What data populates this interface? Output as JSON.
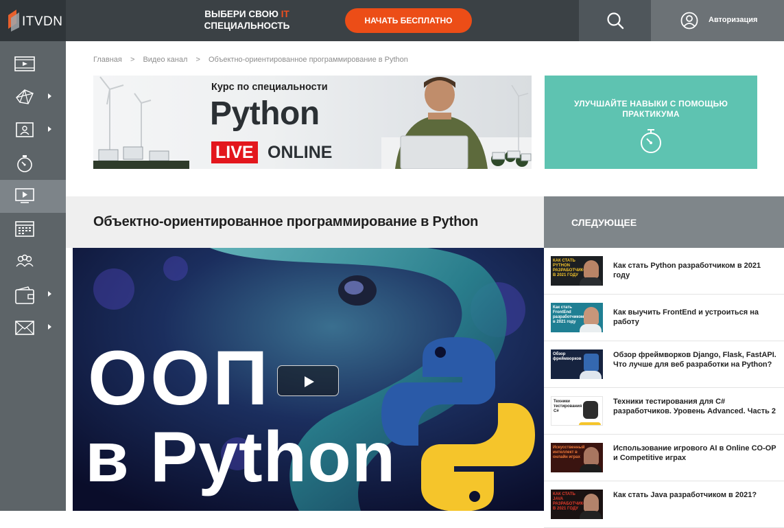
{
  "brand": {
    "name": "ITVDN"
  },
  "header": {
    "slogan_line1": "ВЫБЕРИ СВОЮ",
    "slogan_accent": "IT",
    "slogan_line2": "СПЕЦИАЛЬНОСТЬ",
    "cta_label": "НАЧАТЬ БЕСПЛАТНО",
    "auth_label": "Авторизация"
  },
  "sidebar": {
    "items": [
      {
        "icon": "video-library-icon",
        "has_submenu": false
      },
      {
        "icon": "network-icon",
        "has_submenu": true
      },
      {
        "icon": "teacher-icon",
        "has_submenu": true
      },
      {
        "icon": "stopwatch-icon",
        "has_submenu": false
      },
      {
        "icon": "play-screen-icon",
        "has_submenu": false,
        "active": true
      },
      {
        "icon": "calendar-icon",
        "has_submenu": false
      },
      {
        "icon": "users-icon",
        "has_submenu": false
      },
      {
        "icon": "wallet-icon",
        "has_submenu": true
      },
      {
        "icon": "mail-icon",
        "has_submenu": true
      }
    ]
  },
  "breadcrumb": {
    "items": [
      "Главная",
      "Видео канал",
      "Объектно-ориентированное программирование в Python"
    ],
    "separator": ">"
  },
  "banner": {
    "kicker": "Курс по специальности",
    "title": "Python",
    "live": "LIVE",
    "online": "ONLINE"
  },
  "promo": {
    "text": "УЛУЧШАЙТЕ НАВЫКИ С ПОМОЩЬЮ ПРАКТИКУМА",
    "icon": "stopwatch-icon"
  },
  "page": {
    "title": "Объектно-ориентированное программирование в Python"
  },
  "video": {
    "overlay_line1": "ООП",
    "overlay_line2": "в Python"
  },
  "next": {
    "heading": "СЛЕДУЮЩЕЕ",
    "items": [
      {
        "title": "Как стать Python разработчиком в 2021 году",
        "thumb_text": "КАК СТАТЬ PYTHON РАЗРАБОТЧИКОМ В 2021 ГОДУ"
      },
      {
        "title": "Как выучить FrontEnd и устроиться на работу",
        "thumb_text": "Как стать FrontEnd разработчиком в 2021 году"
      },
      {
        "title": "Обзор фреймворков Django, Flask, FastAPI. Что лучше для веб разработки на Python?",
        "thumb_text": "Обзор фреймворков"
      },
      {
        "title": "Техники тестирования для C# разработчиков. Уровень Advanced. Часть 2",
        "thumb_text": "Техники тестирования C#"
      },
      {
        "title": "Использование игрового AI в Online CO-OP и Competitive играх",
        "thumb_text": "Искусственный интеллект в онлайн играх"
      },
      {
        "title": "Как стать Java разработчиком в 2021?",
        "thumb_text": "КАК СТАТЬ JAVA РАЗРАБОТЧИКОМ В 2021 ГОДУ"
      }
    ]
  },
  "colors": {
    "accent": "#ec4d17",
    "header_bg": "#3b4145",
    "sidebar_bg": "#5d6468",
    "promo_bg": "#5ec3b1",
    "next_head_bg": "#7f868a",
    "live_red": "#e3171d"
  }
}
